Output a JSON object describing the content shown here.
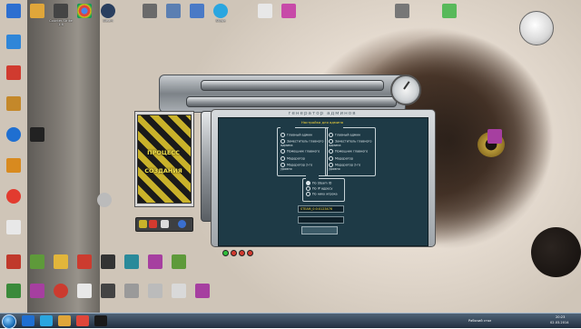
{
  "desktop_icons": [
    {
      "label": "",
      "color": "#2d6fd0",
      "icon": "computer-icon"
    },
    {
      "label": "",
      "color": "#e0a63a",
      "icon": "user-folder-icon"
    },
    {
      "label": "Counter-Strike 1.6",
      "color": "#444444",
      "icon": "counter-strike-icon"
    },
    {
      "label": "",
      "color": "#e0463a",
      "icon": "chrome-icon"
    },
    {
      "label": "Steam",
      "color": "#2a3f5f",
      "icon": "steam-icon"
    },
    {
      "label": "",
      "color": "#6a6a6a",
      "icon": "app-icon"
    },
    {
      "label": "",
      "color": "#5b7fb2",
      "icon": "app-icon"
    },
    {
      "label": "",
      "color": "#4a7ac6",
      "icon": "app-icon"
    },
    {
      "label": "Skype",
      "color": "#2aa6e0",
      "icon": "skype-icon"
    },
    {
      "label": "",
      "color": "#e8e8e8",
      "icon": "document-icon"
    },
    {
      "label": "",
      "color": "#c74aa8",
      "icon": "paint-icon"
    },
    {
      "label": "",
      "color": "#777777",
      "icon": "image-file-icon"
    },
    {
      "label": "",
      "color": "#58b95a",
      "icon": "app-icon"
    }
  ],
  "app": {
    "panel_title": "генератор админов",
    "settings_title": "Настройка для админа",
    "hazard_line1": "ПРОЦЕСС",
    "hazard_line2": "СОЗДАНИЯ",
    "left_group": [
      "Главный админ",
      "Заместитель главного админа",
      "Помощник главного",
      "Модератор",
      "Модератор 2-го уровня"
    ],
    "right_group": [
      "Главный админ",
      "Заместитель главного админа",
      "Помощник главного",
      "Модератор",
      "Модератор 2-го уровня"
    ],
    "mid_group": [
      "По Steam ID",
      "По IP адресу",
      "По нику игрока"
    ],
    "field1_value": "STEAM_0:0:0123476",
    "field2_value": "",
    "create_label": ""
  },
  "taskbar": {
    "language": "Рабочий стол",
    "time": "20:23",
    "date": "02.03.2014"
  }
}
